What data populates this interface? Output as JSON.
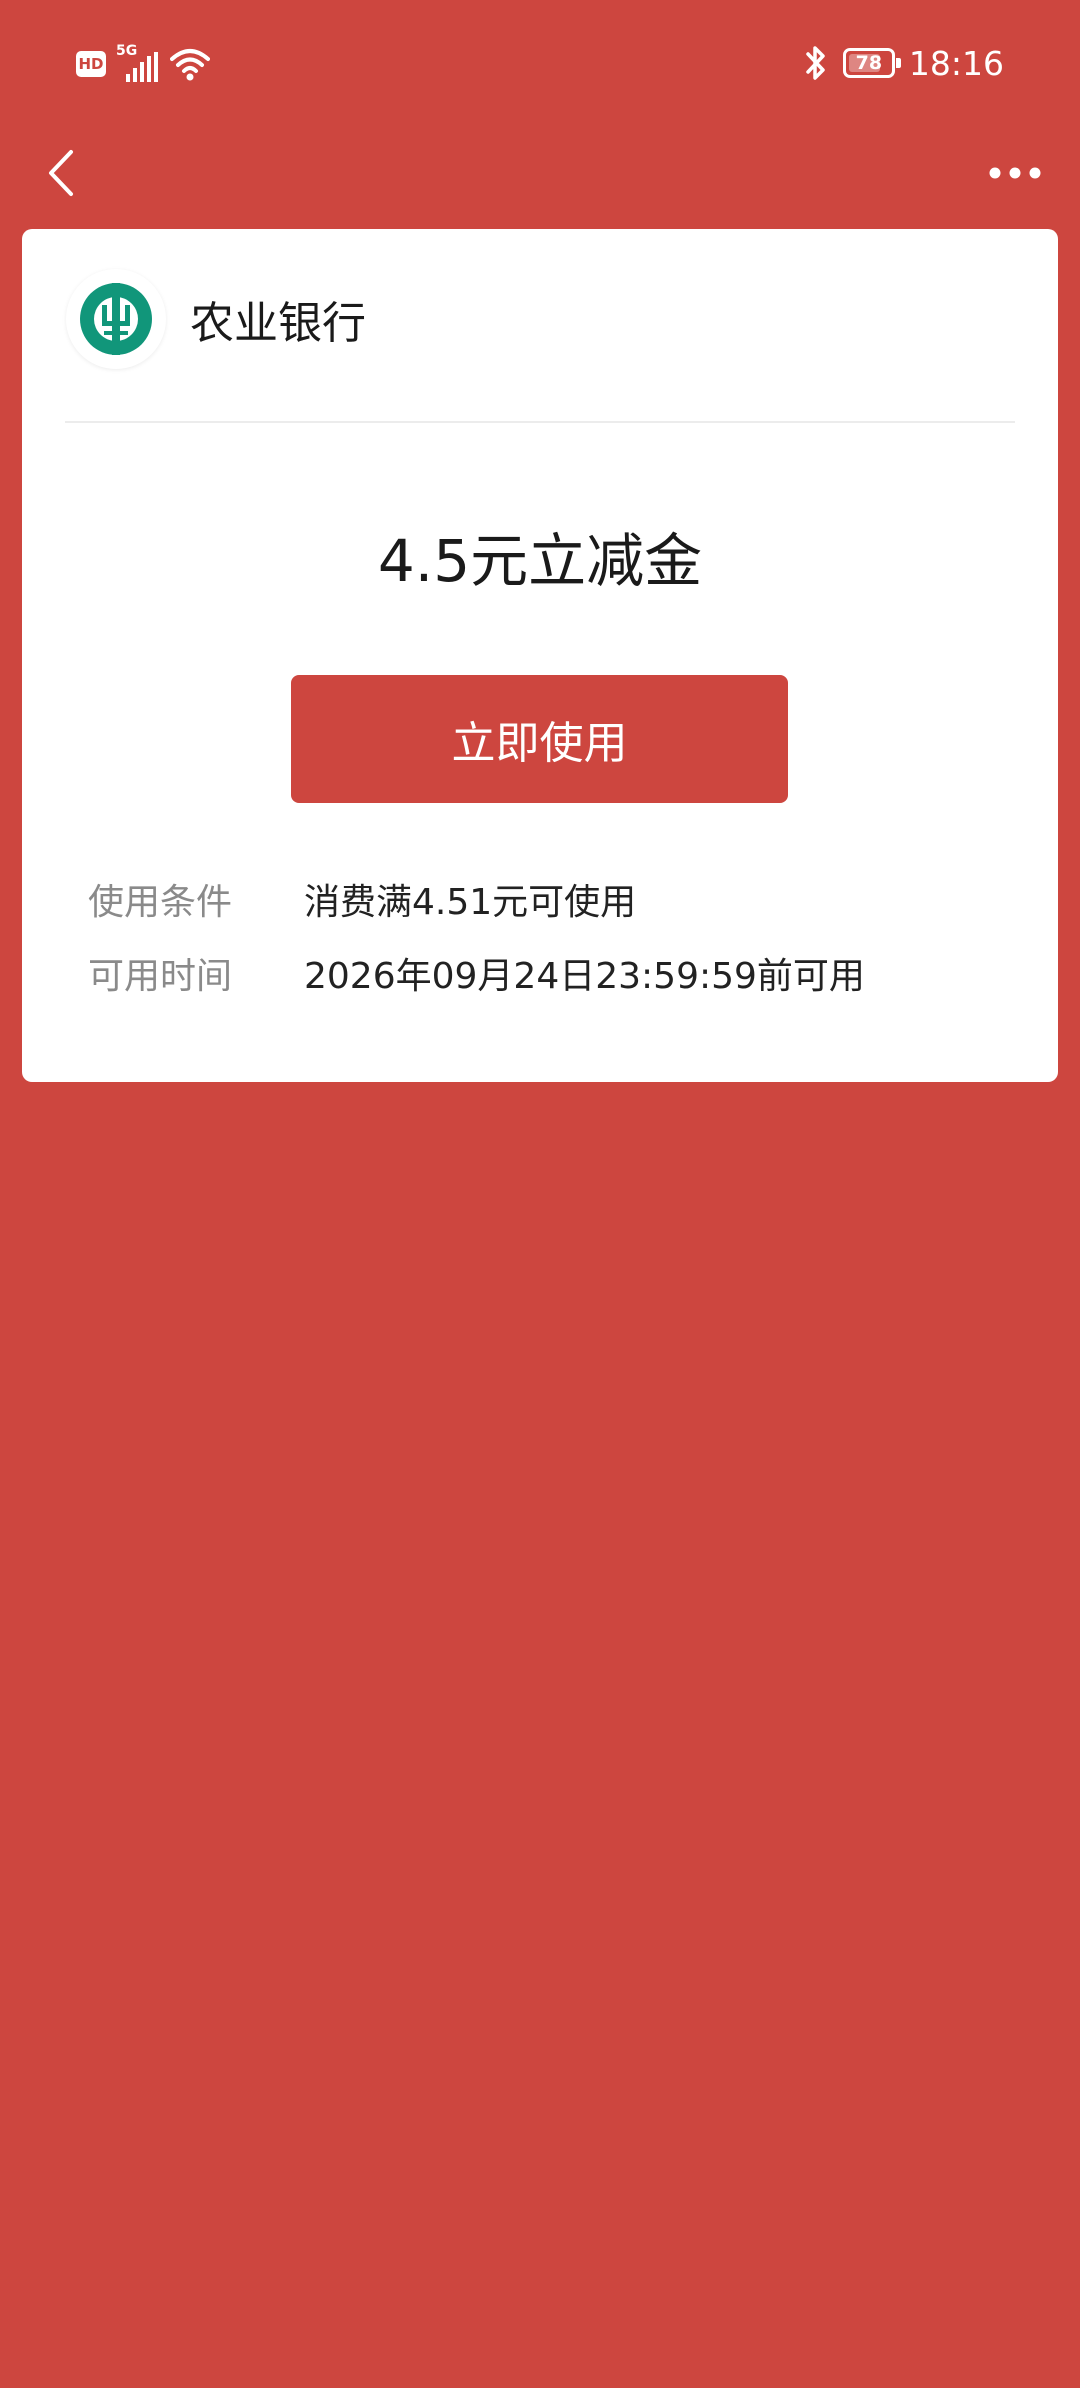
{
  "status_bar": {
    "hd_label": "HD",
    "network_label": "5G",
    "battery_level": "78",
    "battery_percent": 78,
    "time": "18:16",
    "icons": [
      "hd-badge-icon",
      "signal-icon",
      "wifi-icon",
      "bluetooth-icon",
      "battery-icon"
    ]
  },
  "nav": {
    "back_icon": "chevron-left-icon",
    "more_icon": "more-dots-icon"
  },
  "coupon": {
    "bank_name": "农业银行",
    "bank_logo_icon": "agricultural-bank-logo-icon",
    "title": "4.5元立减金",
    "action_label": "立即使用",
    "details": [
      {
        "label": "使用条件",
        "value": "消费满4.51元可使用"
      },
      {
        "label": "可用时间",
        "value": "2026年09月24日23:59:59前可用"
      }
    ]
  },
  "colors": {
    "brand_red": "#CD463F",
    "card_bg": "#FFFFFF",
    "logo_green": "#11967A",
    "label_gray": "#8A8A8A",
    "text_dark": "#1A1A1A"
  }
}
